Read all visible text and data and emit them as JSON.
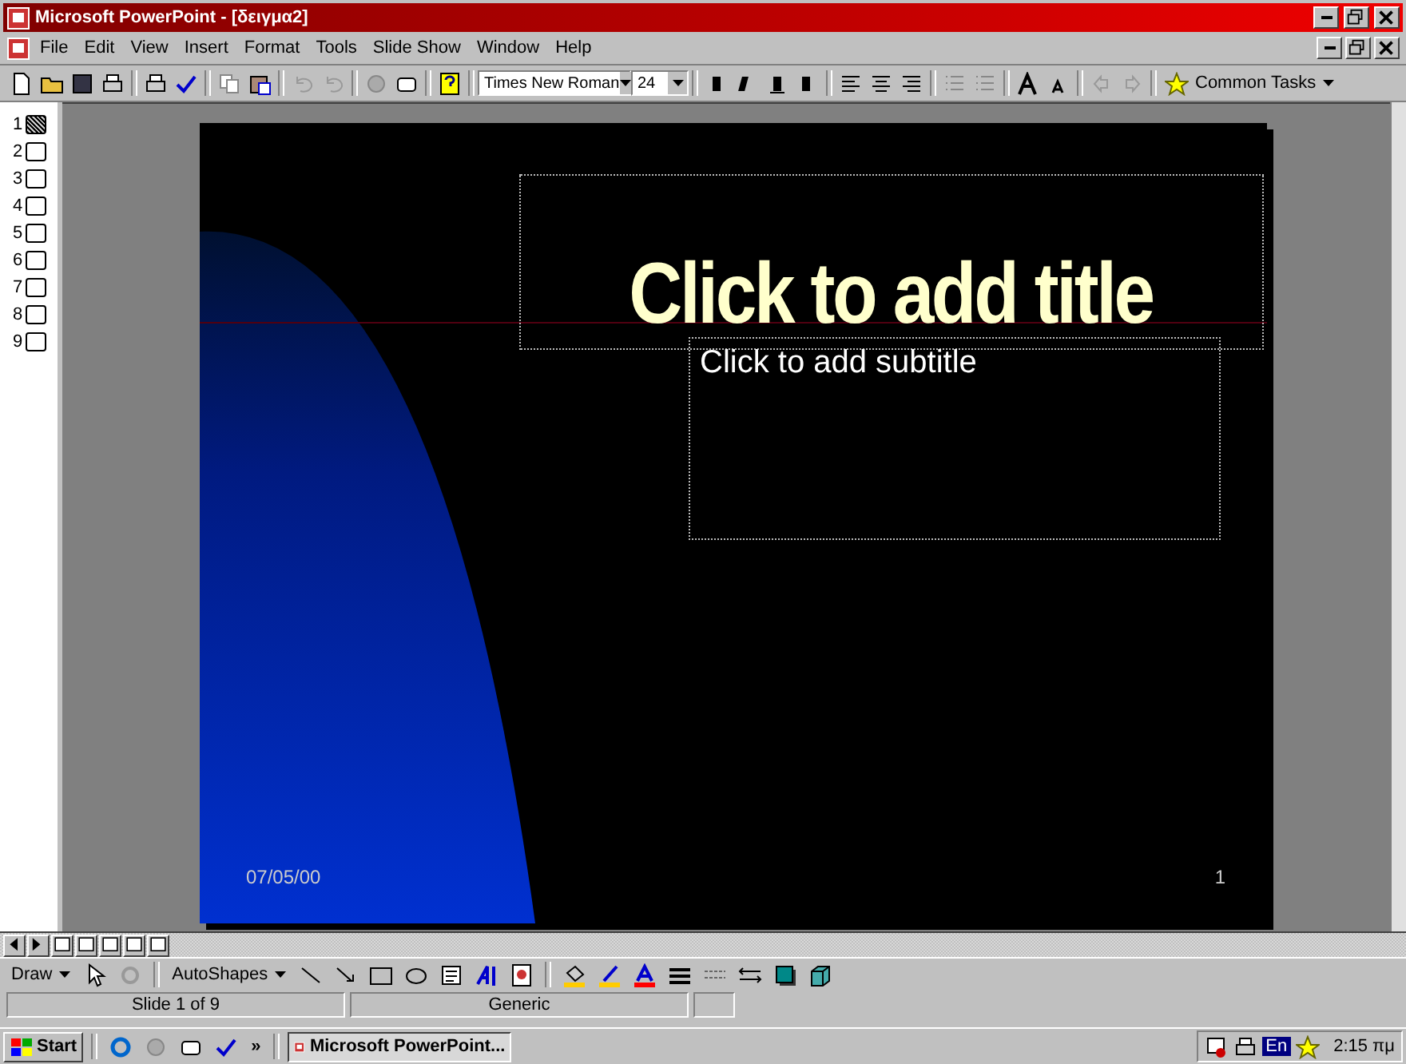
{
  "window": {
    "title": "Microsoft PowerPoint - [δειγμα2]"
  },
  "menu": [
    "File",
    "Edit",
    "View",
    "Insert",
    "Format",
    "Tools",
    "Slide Show",
    "Window",
    "Help"
  ],
  "formatting": {
    "font": "Times New Roman",
    "size": "24",
    "common_tasks": "Common Tasks"
  },
  "outline": [
    {
      "number": "1",
      "selected": true
    },
    {
      "number": "2",
      "selected": false
    },
    {
      "number": "3",
      "selected": false
    },
    {
      "number": "4",
      "selected": false
    },
    {
      "number": "5",
      "selected": false
    },
    {
      "number": "6",
      "selected": false
    },
    {
      "number": "7",
      "selected": false
    },
    {
      "number": "8",
      "selected": false
    },
    {
      "number": "9",
      "selected": false
    }
  ],
  "slide": {
    "title": "Click to add title",
    "subtitle": "Click to add subtitle",
    "date": "07/05/00",
    "number": "1"
  },
  "drawing_toolbar": {
    "draw": "Draw",
    "autoshapes": "AutoShapes"
  },
  "status_bar": [
    "Slide 1 of 9",
    "Generic"
  ],
  "taskbar": {
    "start": "Start",
    "chevron": "»",
    "task": "Microsoft PowerPoint...",
    "language": "En",
    "clock": "2:15 πμ"
  }
}
